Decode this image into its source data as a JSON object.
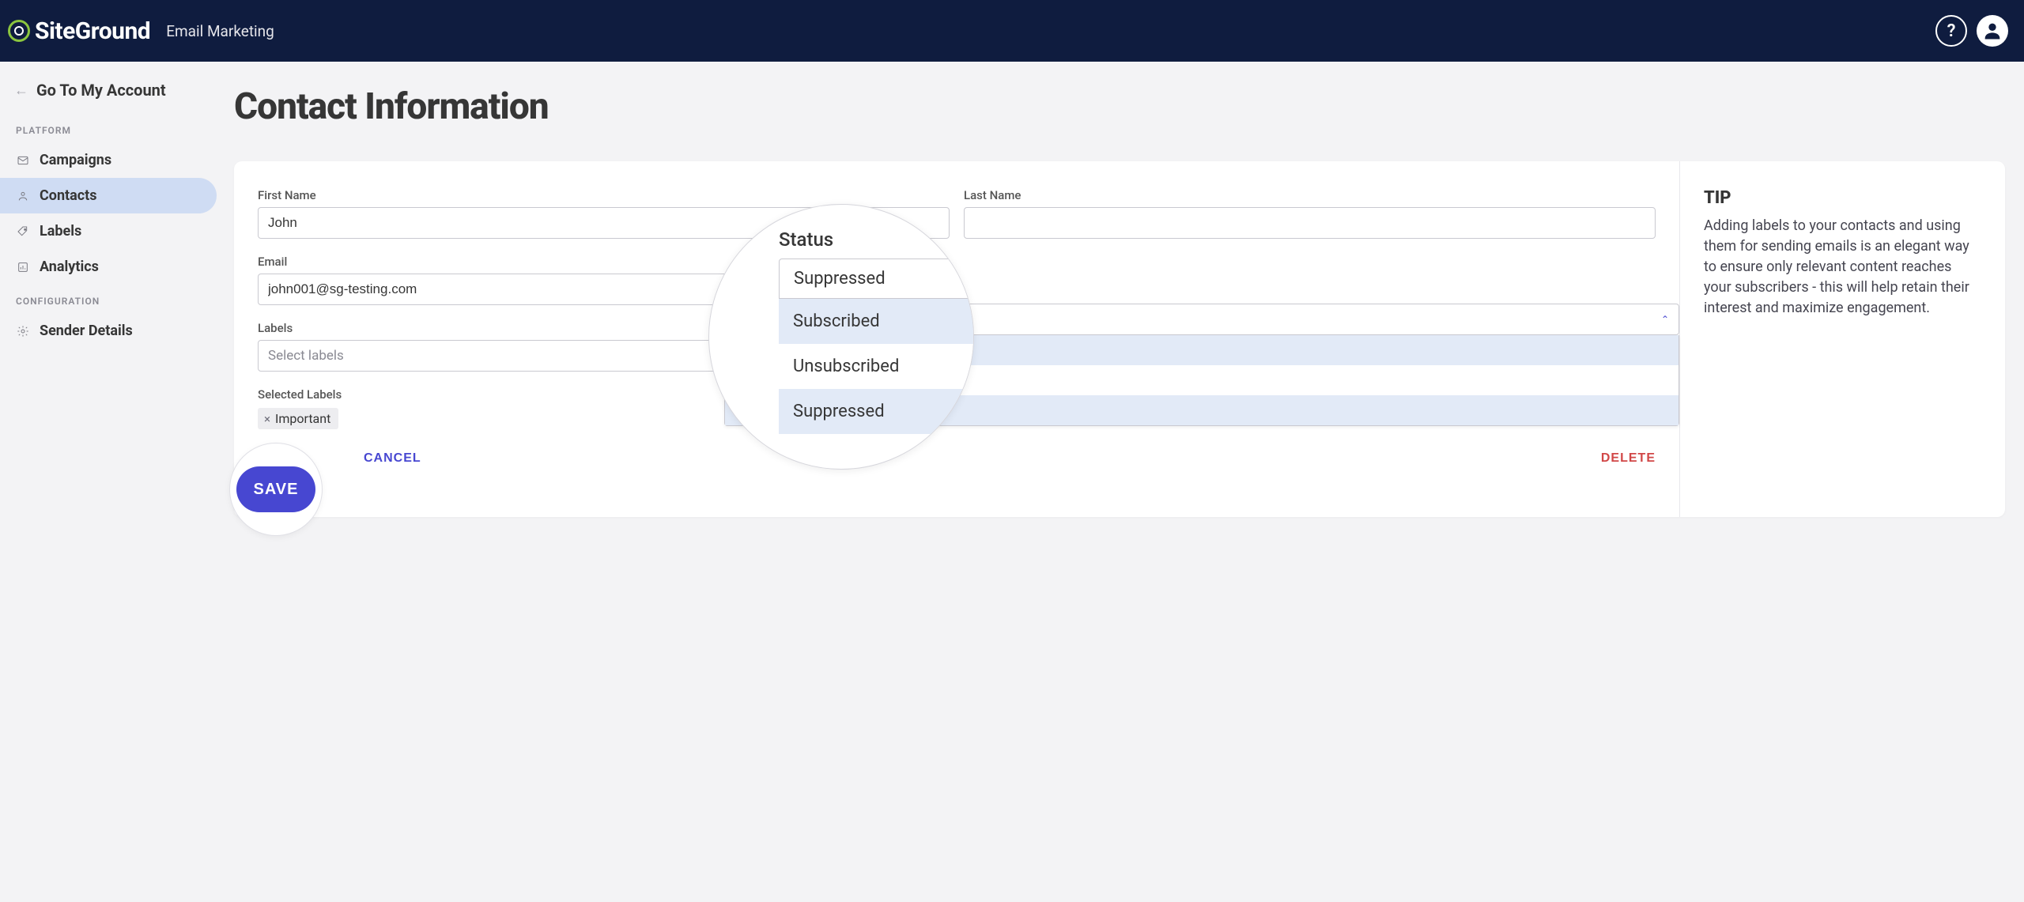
{
  "header": {
    "brand": "SiteGround",
    "app_title": "Email Marketing"
  },
  "sidebar": {
    "back_link": "Go To My Account",
    "section_platform": "PLATFORM",
    "section_config": "CONFIGURATION",
    "items": {
      "campaigns": "Campaigns",
      "contacts": "Contacts",
      "labels": "Labels",
      "analytics": "Analytics",
      "sender_details": "Sender Details"
    }
  },
  "page": {
    "title": "Contact Information"
  },
  "form": {
    "first_name_label": "First Name",
    "first_name_value": "John",
    "last_name_label": "Last Name",
    "last_name_value": "",
    "email_label": "Email",
    "email_value": "john001@sg-testing.com",
    "labels_label": "Labels",
    "labels_placeholder": "Select labels",
    "selected_labels_label": "Selected Labels",
    "selected_chip": "Important"
  },
  "status_dropdown": {
    "label": "Status",
    "selected": "Suppressed",
    "options": [
      "Subscribed",
      "Unsubscribed",
      "Suppressed"
    ]
  },
  "actions": {
    "save": "SAVE",
    "cancel": "CANCEL",
    "delete": "DELETE"
  },
  "tip": {
    "title": "TIP",
    "body": "Adding labels to your contacts and using them for sending emails is an elegant way to ensure only relevant content reaches your subscribers - this will help retain their interest and maximize engagement."
  }
}
